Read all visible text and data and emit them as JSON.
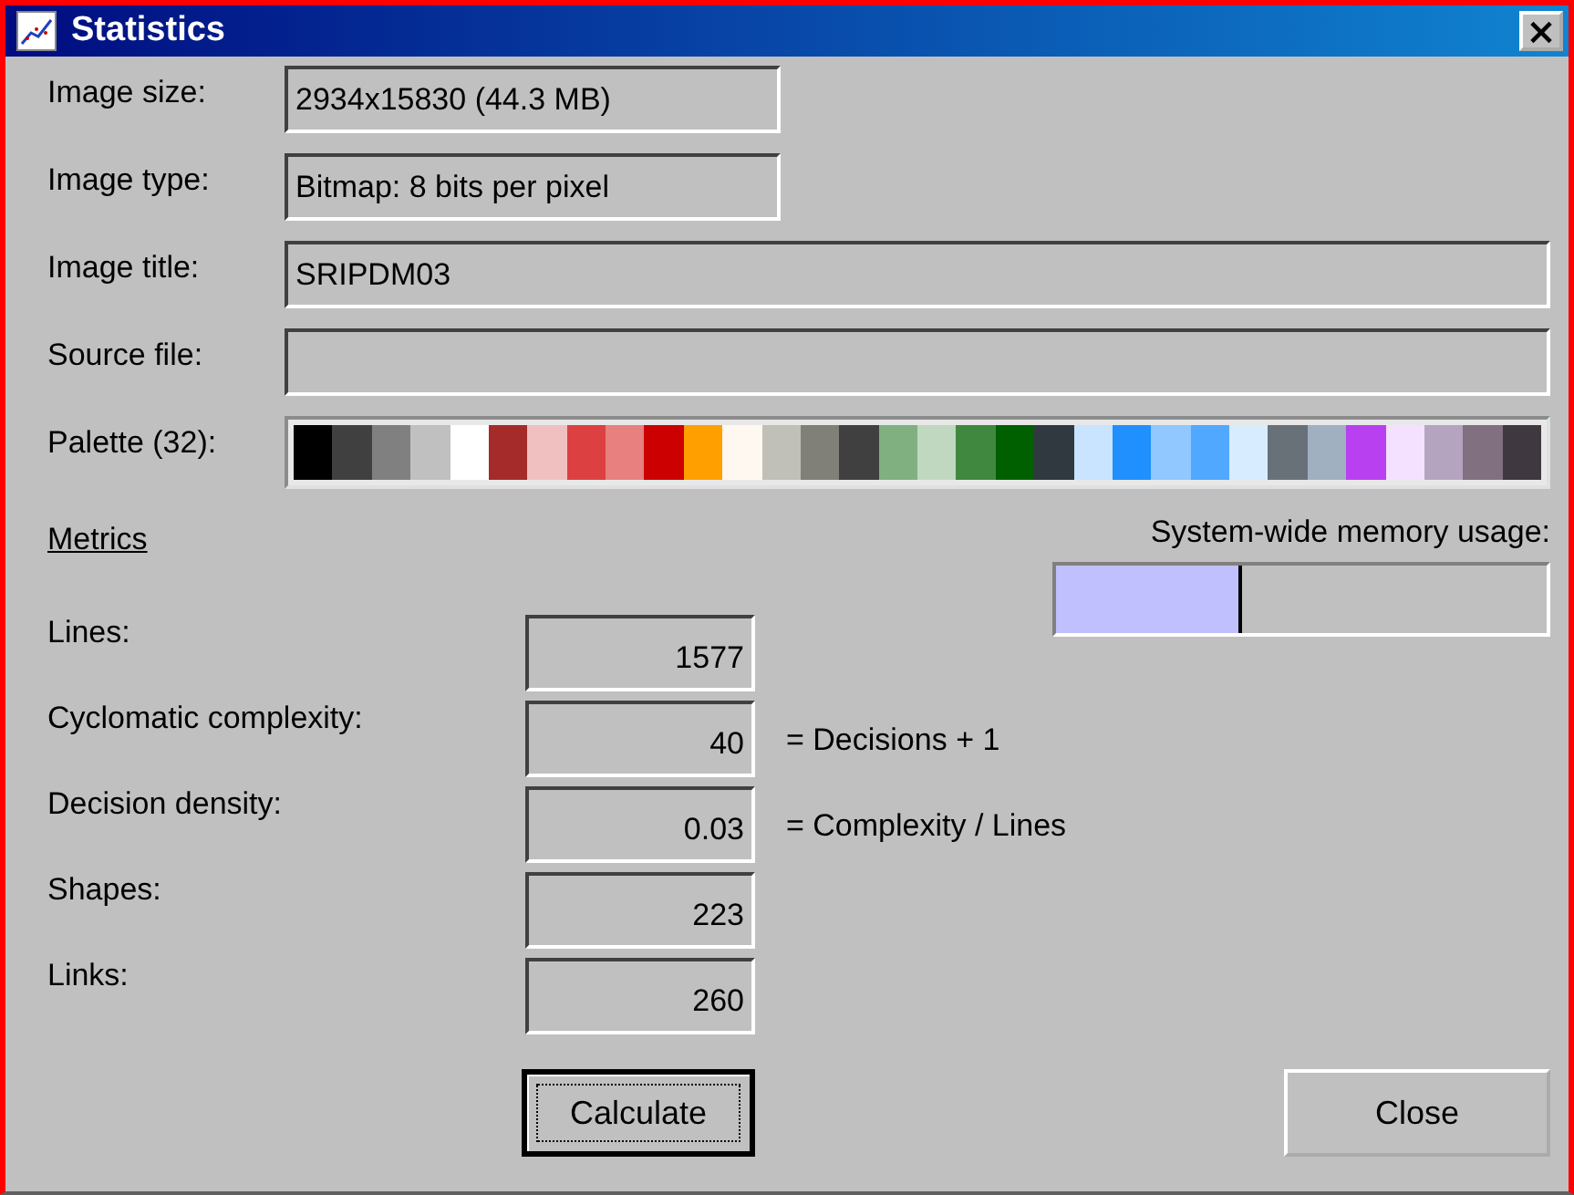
{
  "window": {
    "title": "Statistics",
    "close": "×"
  },
  "info": [
    {
      "label": "Image size:",
      "value": "2934x15830 (44.3 MB)",
      "wide": false
    },
    {
      "label": "Image type:",
      "value": "Bitmap: 8 bits per pixel",
      "wide": false
    },
    {
      "label": "Image title:",
      "value": "SRIPDM03",
      "wide": true
    },
    {
      "label": "Source file:",
      "wide": true
    }
  ],
  "palette": {
    "label": "Palette (32):",
    "swatches": [
      {
        "color": "#000000"
      },
      {
        "color": "#404040"
      },
      {
        "color": "#808080"
      },
      {
        "color": "#c0c0c0"
      },
      {
        "color": "#ffffff"
      },
      {
        "color": "#a52a2a"
      },
      {
        "color": "#f0c0c0"
      },
      {
        "color": "#dc4040"
      },
      {
        "color": "#e88080"
      },
      {
        "color": "#cc0000"
      },
      {
        "color": "#ffa000"
      },
      {
        "color": "#fff8f0"
      },
      {
        "color": "#c0c0b8"
      },
      {
        "color": "#808078"
      },
      {
        "color": "#404040"
      },
      {
        "color": "#80b080"
      },
      {
        "color": "#c0d8c0"
      },
      {
        "color": "#408840"
      },
      {
        "color": "#006000"
      },
      {
        "color": "#303840"
      },
      {
        "color": "#c8e4ff"
      },
      {
        "color": "#2090ff"
      },
      {
        "color": "#90c8ff"
      },
      {
        "color": "#50a8ff"
      },
      {
        "color": "#d8ecff"
      },
      {
        "color": "#687078"
      },
      {
        "color": "#a0b0c0"
      },
      {
        "color": "#b840f0"
      },
      {
        "color": "#f4e0ff"
      },
      {
        "color": "#b4a4c0"
      },
      {
        "color": "#807080"
      },
      {
        "color": "#403840"
      }
    ]
  },
  "metrics_heading": "Metrics",
  "memory": {
    "label": "System-wide memory usage:",
    "level": 0.38
  },
  "metrics": [
    {
      "label": "Lines:",
      "value": "1577"
    },
    {
      "label": "Cyclomatic complexity:",
      "value": "40",
      "note": "= Decisions + 1"
    },
    {
      "label": "Decision density:",
      "value": "0.03",
      "note": "= Complexity / Lines"
    },
    {
      "label": "Shapes:",
      "value": "223"
    },
    {
      "label": "Links:",
      "value": "260"
    }
  ],
  "buttons": [
    {
      "label": "Calculate",
      "focused": true
    },
    {
      "label": "Close",
      "focused": false
    }
  ]
}
